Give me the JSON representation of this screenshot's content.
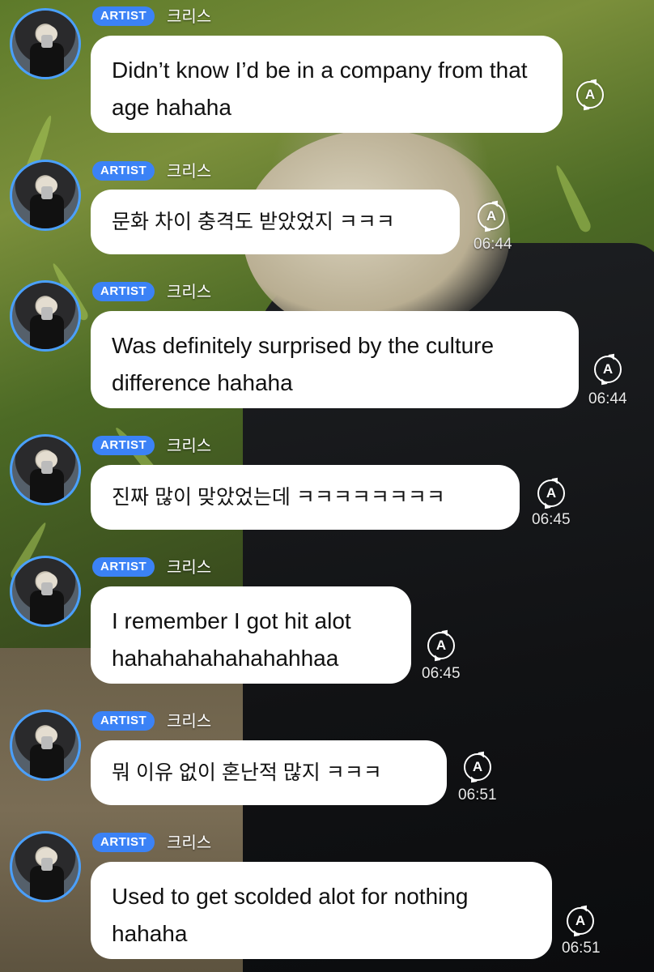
{
  "messages": [
    {
      "badge": "ARTIST",
      "name": "크리스",
      "text": "Didn’t know I’d be in a company from that age hahaha",
      "time": "",
      "translate_icon": "translate-icon"
    },
    {
      "badge": "ARTIST",
      "name": "크리스",
      "text": "문화 차이 충격도 받았었지 ㅋㅋㅋ",
      "time": "06:44",
      "translate_icon": "translate-icon"
    },
    {
      "badge": "ARTIST",
      "name": "크리스",
      "text": "Was definitely surprised by the culture difference hahaha",
      "time": "06:44",
      "translate_icon": "translate-icon"
    },
    {
      "badge": "ARTIST",
      "name": "크리스",
      "text": "진짜 많이 맞았었는데 ㅋㅋㅋㅋㅋㅋㅋㅋ",
      "time": "06:45",
      "translate_icon": "translate-icon"
    },
    {
      "badge": "ARTIST",
      "name": "크리스",
      "text": "I remember I got hit alot hahahahahahahahhaa",
      "time": "06:45",
      "translate_icon": "translate-icon"
    },
    {
      "badge": "ARTIST",
      "name": "크리스",
      "text": "뭐 이유 없이 혼난적 많지 ㅋㅋㅋ",
      "time": "06:51",
      "translate_icon": "translate-icon"
    },
    {
      "badge": "ARTIST",
      "name": "크리스",
      "text": "Used to get scolded alot for nothing hahaha",
      "time": "06:51",
      "translate_icon": "translate-icon"
    }
  ],
  "translate_label": "A",
  "colors": {
    "badge": "#3b82f6",
    "avatar_ring": "#4aa0ff",
    "bubble": "#ffffff"
  }
}
